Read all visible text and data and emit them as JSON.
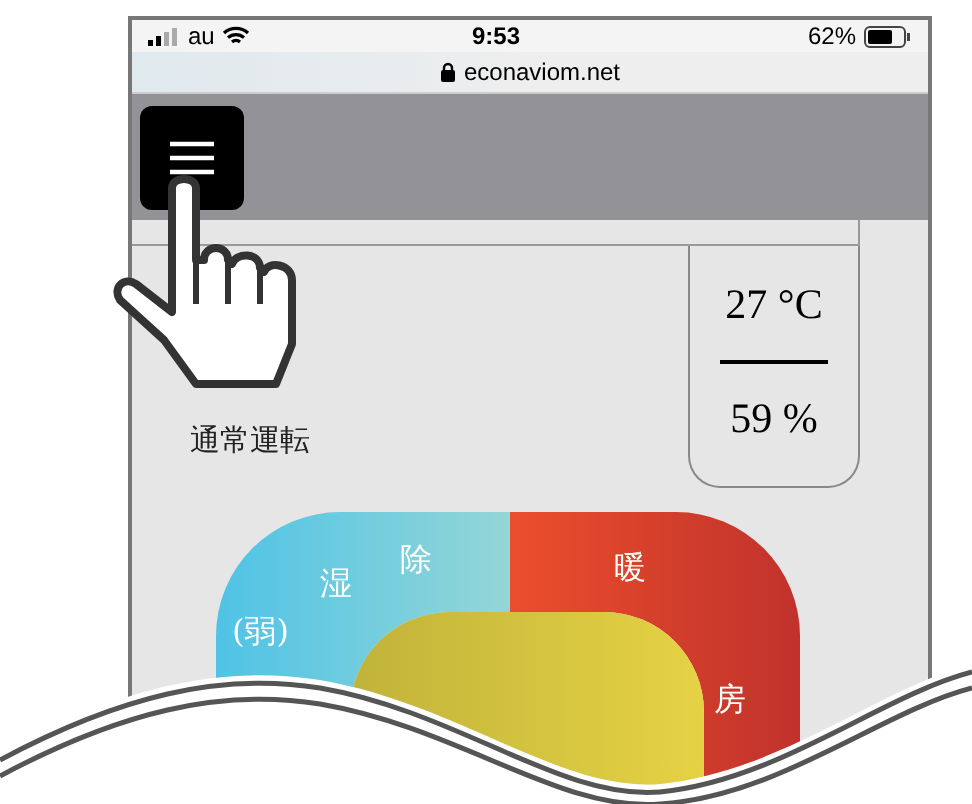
{
  "status_bar": {
    "carrier": "au",
    "time": "9:53",
    "battery": "62%"
  },
  "address_bar": {
    "url": "econaviom.net"
  },
  "mode_label": "通常運転",
  "readout": {
    "temperature": "27 °C",
    "humidity": "59 %"
  },
  "mode_dial": {
    "segments": [
      {
        "kind": "dehumidify",
        "labels": [
          "除",
          "湿",
          "(弱)"
        ]
      },
      {
        "kind": "heating",
        "labels": [
          "暖",
          "房"
        ]
      },
      {
        "kind": "auto"
      }
    ]
  }
}
